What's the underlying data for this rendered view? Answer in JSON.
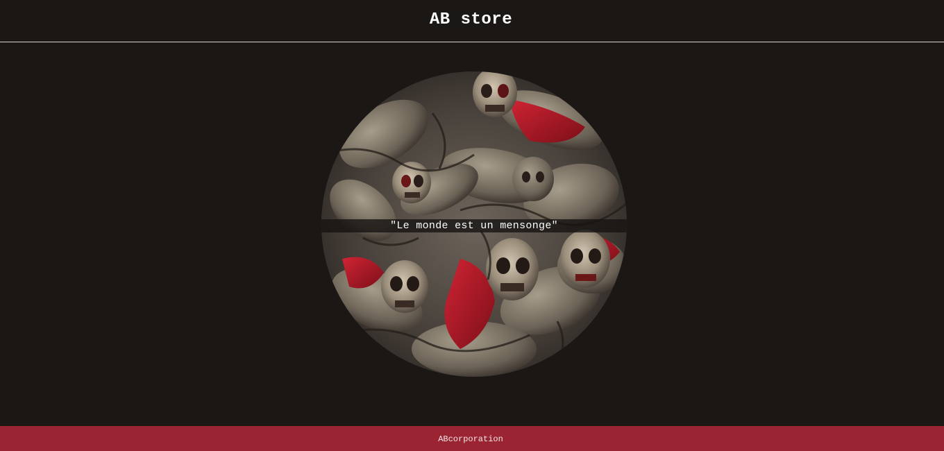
{
  "header": {
    "title": "AB store"
  },
  "hero": {
    "image_label": "dark-armored-skulls-artwork",
    "quote": "\"Le monde est un mensonge\""
  },
  "footer": {
    "text": "ABcorporation"
  },
  "colors": {
    "background": "#1b1715",
    "header_divider": "#d8d4d0",
    "footer": "#9a2431",
    "accent_red": "#b01c2b",
    "armor_stone": "#8b8273"
  }
}
